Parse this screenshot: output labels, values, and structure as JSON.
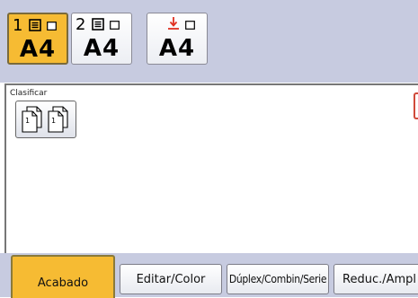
{
  "trays": [
    {
      "number": "1",
      "size": "A4",
      "active": true,
      "icon": "paper-tray-icon"
    },
    {
      "number": "2",
      "size": "A4",
      "active": false,
      "icon": "paper-tray-icon"
    },
    {
      "number": "",
      "size": "A4",
      "active": false,
      "icon": "bypass-tray-icon"
    }
  ],
  "finishing": {
    "section_label": "Clasificar",
    "sort_icon": "sort-pages-icon"
  },
  "tabs": [
    {
      "label": "Acabado",
      "active": true
    },
    {
      "label": "Editar/Color",
      "active": false
    },
    {
      "label": "Dúplex/Combin/Serie",
      "active": false
    },
    {
      "label": "Reduc./Ampl",
      "active": false
    }
  ],
  "colors": {
    "accent": "#f6bb33",
    "toolbar_bg": "#c7cbe0",
    "bypass_arrow": "#e03020"
  }
}
